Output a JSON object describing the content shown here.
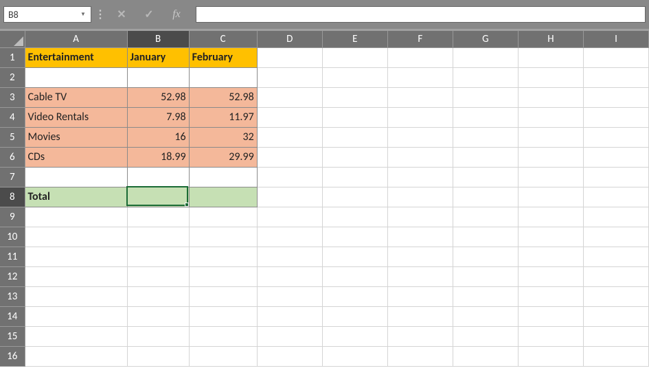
{
  "formula_bar": {
    "name_box": "B8",
    "cancel_glyph": "✕",
    "enter_glyph": "✓",
    "fx_label": "fx",
    "formula_value": ""
  },
  "columns": [
    "A",
    "B",
    "C",
    "D",
    "E",
    "F",
    "G",
    "H",
    "I"
  ],
  "active_col": "B",
  "active_row": 8,
  "row_count": 16,
  "chart_data": {
    "type": "table",
    "title": "Entertainment",
    "categories": [
      "January",
      "February"
    ],
    "series": [
      {
        "name": "Cable TV",
        "values": [
          52.98,
          52.98
        ]
      },
      {
        "name": "Video Rentals",
        "values": [
          7.98,
          11.97
        ]
      },
      {
        "name": "Movies",
        "values": [
          16,
          32
        ]
      },
      {
        "name": "CDs",
        "values": [
          18.99,
          29.99
        ]
      }
    ],
    "total_label": "Total"
  },
  "colors": {
    "header_fill": "#ffc000",
    "data_fill": "#f4b89a",
    "total_fill": "#c6e0b4",
    "selection": "#1a6a34",
    "header_bg": "#717171"
  }
}
